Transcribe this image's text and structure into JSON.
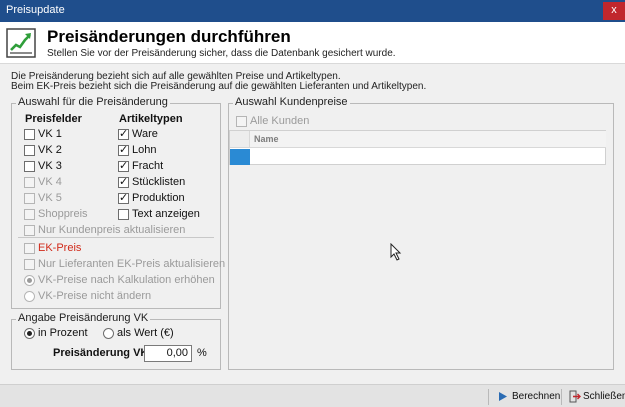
{
  "window": {
    "title": "Preisupdate",
    "close_glyph": "x"
  },
  "header": {
    "icon": "chart-trend-icon",
    "title": "Preisänderungen durchführen",
    "subtitle": "Stellen Sie vor der Preisänderung sicher, dass die Datenbank gesichert wurde."
  },
  "info": {
    "line1": "Die Preisänderung bezieht sich auf alle gewählten Preise und Artikeltypen.",
    "line2": "Beim EK-Preis bezieht sich die Preisänderung auf die gewählten Lieferanten und Artikeltypen."
  },
  "auswahl": {
    "title": "Auswahl für die Preisänderung",
    "preisfelder_header": "Preisfelder",
    "artikeltypen_header": "Artikeltypen",
    "preisfelder": [
      {
        "label": "VK  1",
        "checked": false,
        "disabled": false
      },
      {
        "label": "VK  2",
        "checked": false,
        "disabled": false
      },
      {
        "label": "VK  3",
        "checked": false,
        "disabled": false
      },
      {
        "label": "VK  4",
        "checked": false,
        "disabled": true
      },
      {
        "label": "VK  5",
        "checked": false,
        "disabled": true
      },
      {
        "label": "Shoppreis",
        "checked": false,
        "disabled": true
      }
    ],
    "artikeltypen": [
      {
        "label": "Ware",
        "checked": true
      },
      {
        "label": "Lohn",
        "checked": true
      },
      {
        "label": "Fracht",
        "checked": true
      },
      {
        "label": "Stücklisten",
        "checked": true
      },
      {
        "label": "Produktion",
        "checked": true
      },
      {
        "label": "Text anzeigen",
        "checked": false
      }
    ],
    "nur_kundenpreis": "Nur Kundenpreis aktualisieren",
    "ek_preis": "EK-Preis",
    "nur_lieferanten": "Nur Lieferanten EK-Preis aktualisieren",
    "radio_kalkulation": "VK-Preise nach Kalkulation erhöhen",
    "radio_nicht_aendern": "VK-Preise nicht ändern"
  },
  "angabe": {
    "title": "Angabe Preisänderung VK",
    "in_prozent": "in Prozent",
    "als_wert": "als Wert (€)",
    "field_label": "Preisänderung VK:",
    "field_value": "0,00",
    "unit": "%"
  },
  "kundenpreise": {
    "title": "Auswahl Kundenpreise",
    "alle_kunden": "Alle Kunden",
    "column_name": "Name"
  },
  "footer": {
    "berechnen": "Berechnen",
    "schliessen": "Schließen"
  },
  "colors": {
    "titlebar": "#1f4e8c",
    "close": "#c1272d",
    "ek_red": "#d12a1a",
    "row_selector": "#2a8ad4"
  }
}
